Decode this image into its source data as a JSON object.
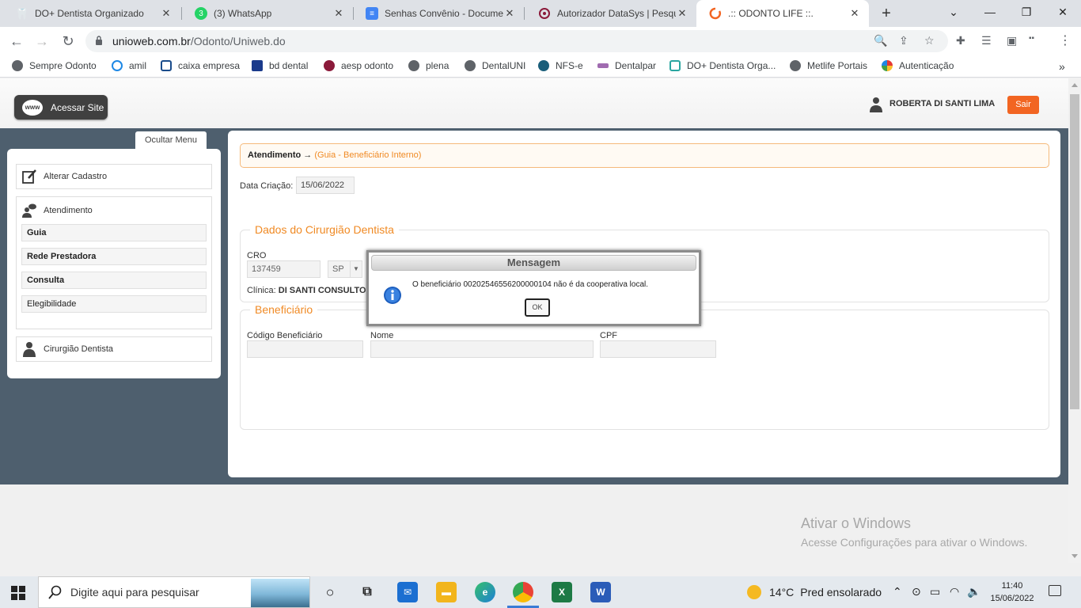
{
  "browser": {
    "tabs": [
      {
        "title": "DO+ Dentista Organizado",
        "active": false
      },
      {
        "title": "(3) WhatsApp",
        "active": false
      },
      {
        "title": "Senhas Convênio - Documen",
        "active": false
      },
      {
        "title": "Autorizador DataSys | Pesqui",
        "active": false
      },
      {
        "title": ".:: ODONTO LIFE ::.",
        "active": true
      }
    ],
    "whatsapp_badge": "3",
    "url_host": "unioweb.com.br",
    "url_path": "/Odonto/Uniweb.do",
    "bookmarks": [
      "Sempre Odonto",
      "amil",
      "caixa empresa",
      "bd dental",
      "aesp odonto",
      "plena",
      "DentalUNI",
      "NFS-e",
      "Dentalpar",
      "DO+ Dentista Orga...",
      "Metlife Portais",
      "Autenticação"
    ]
  },
  "header": {
    "site_button": "Acessar Site",
    "site_globe": "www",
    "user_name": "ROBERTA DI SANTI LIMA",
    "logout": "Sair"
  },
  "sidebar": {
    "toggle": "Ocultar Menu",
    "alterar": "Alterar Cadastro",
    "atendimento": "Atendimento",
    "sub_items": [
      "Guia",
      "Rede Prestadora",
      "Consulta",
      "Elegibilidade"
    ],
    "cirurgiao": "Cirurgião Dentista"
  },
  "main": {
    "breadcrumb_root": "Atendimento →",
    "breadcrumb_sub": "(Guia - Beneficiário Interno)",
    "data_criacao_label": "Data Criação:",
    "data_criacao": "15/06/2022",
    "dentista": {
      "legend": "Dados do Cirurgião Dentista",
      "cro_label": "CRO",
      "cro": "137459",
      "uf": "SP",
      "clinica_label": "Clínica:",
      "clinica": "DI SANTI CONSULTO"
    },
    "beneficiario": {
      "legend": "Beneficiário",
      "codigo_label": "Código Beneficiário",
      "nome_label": "Nome",
      "cpf_label": "CPF"
    }
  },
  "modal": {
    "title": "Mensagem",
    "message": "O beneficiário 00202546556200000104 não é da cooperativa local.",
    "ok": "OK"
  },
  "watermark": {
    "title": "Ativar o Windows",
    "subtitle": "Acesse Configurações para ativar o Windows."
  },
  "taskbar": {
    "search_placeholder": "Digite aqui para pesquisar",
    "temperature": "14°C",
    "weather": "Pred ensolarado",
    "time": "11:40",
    "date": "15/06/2022"
  },
  "colors": {
    "accent": "#f26522",
    "legend": "#f08a24",
    "page_bg": "#4e5f6e"
  }
}
